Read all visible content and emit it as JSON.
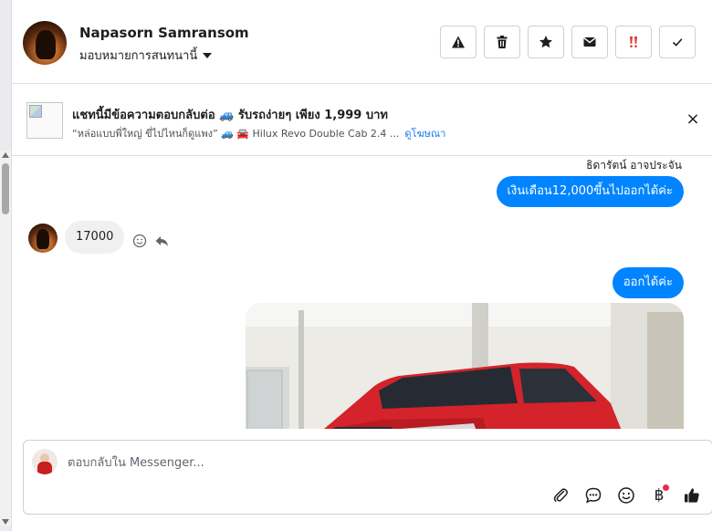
{
  "header": {
    "contact_name": "Napasorn Samransom",
    "assign_label": "มอบหมายการสนทนานี้",
    "toolbar": [
      {
        "name": "spam-button",
        "icon": "warning-icon"
      },
      {
        "name": "delete-button",
        "icon": "trash-icon"
      },
      {
        "name": "star-button",
        "icon": "star-icon"
      },
      {
        "name": "unread-button",
        "icon": "envelope-icon"
      },
      {
        "name": "follow-up-button",
        "icon": "double-exclamation-icon"
      },
      {
        "name": "done-button",
        "icon": "check-icon"
      }
    ]
  },
  "ad": {
    "title": "แชทนี้มีข้อความตอบกลับต่อ 🚙 รับรถง่ายๆ เพียง 1,999 บาท",
    "subtitle": "“หล่อแบบพี่ใหญ่ ขี่ไปไหนก็ดูแพง” 🚙 🚘 Hilux Revo Double Cab 2.4 ...",
    "link": "ดูโฆษณา"
  },
  "thread": {
    "sender_name": "ธิดารัตน์ อาจประจัน",
    "messages": [
      {
        "side": "out",
        "text": "เงินเดือน12,000ขึ้นไปออกได้ค่ะ"
      },
      {
        "side": "in",
        "text": "17000"
      },
      {
        "side": "out",
        "text": "ออกได้ค่ะ"
      }
    ]
  },
  "composer": {
    "placeholder": "ตอบกลับใน Messenger...",
    "tools": [
      "paperclip-icon",
      "saved-reply-icon",
      "emoji-icon",
      "baht-icon",
      "thumbs-up-icon"
    ],
    "baht_symbol": "฿"
  },
  "colors": {
    "accent": "#0084ff",
    "link": "#1877f2",
    "incoming_bubble": "#f1f0f0",
    "notification_dot": "#f02849",
    "follow_up": "#e0352b"
  }
}
